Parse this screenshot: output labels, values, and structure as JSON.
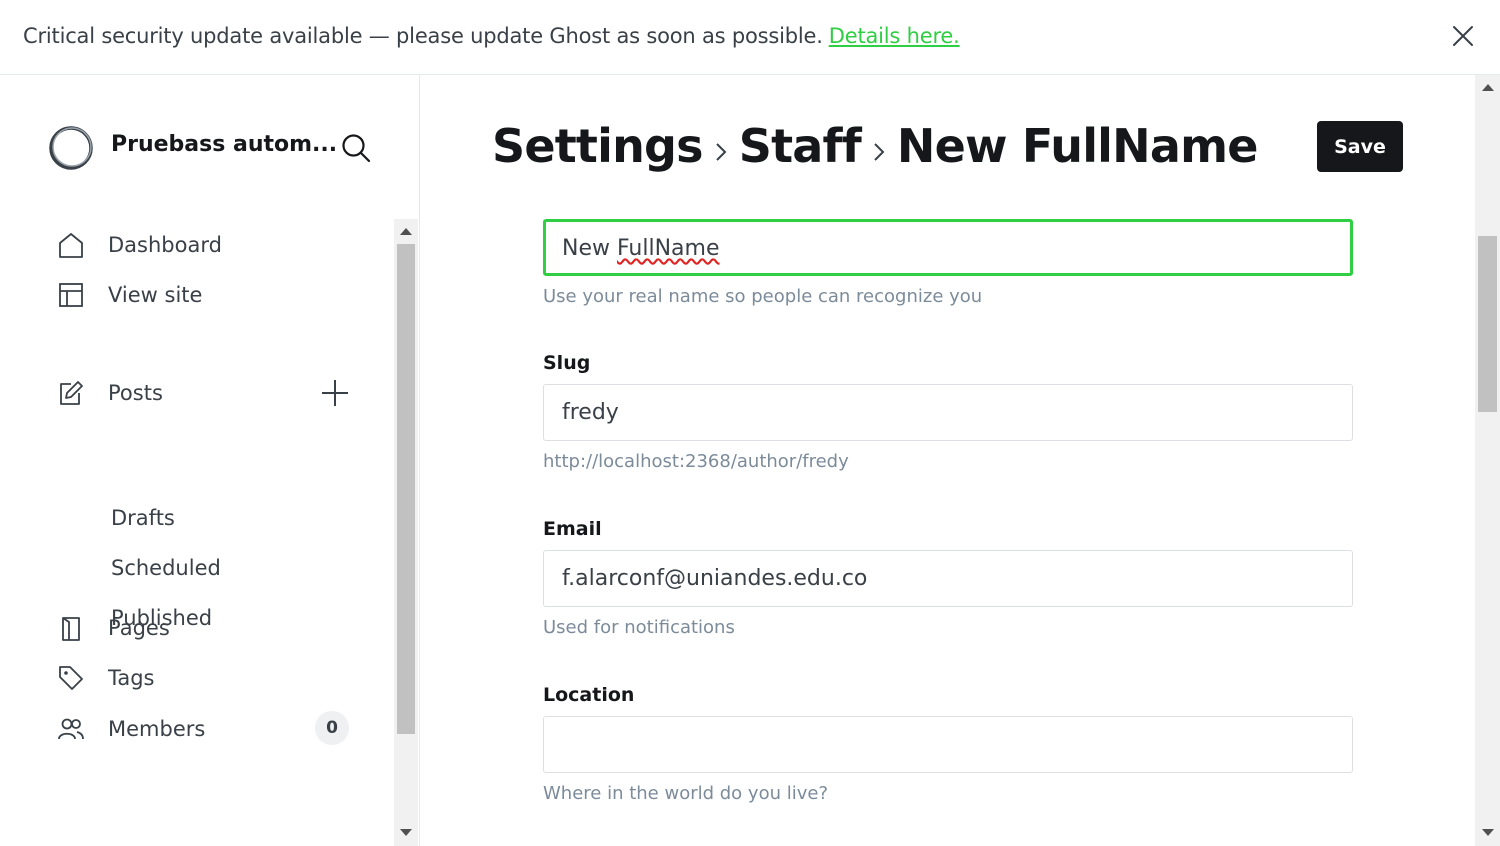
{
  "banner": {
    "message": "Critical security update available — please update Ghost as soon as possible.",
    "link_text": "Details here.",
    "close_icon": "close-icon"
  },
  "sidebar": {
    "site_title": "Pruebass autom...",
    "nav": [
      {
        "label": "Dashboard",
        "icon": "home-icon"
      },
      {
        "label": "View site",
        "icon": "layout-icon"
      },
      {
        "label": "Posts",
        "icon": "edit-icon"
      },
      {
        "label": "Pages",
        "icon": "page-icon"
      },
      {
        "label": "Tags",
        "icon": "tag-icon"
      },
      {
        "label": "Members",
        "icon": "members-icon"
      }
    ],
    "posts_sub": [
      "Drafts",
      "Scheduled",
      "Published"
    ],
    "members_count": "0"
  },
  "header": {
    "crumbs": [
      "Settings",
      "Staff",
      "New FullName"
    ],
    "save_label": "Save"
  },
  "form": {
    "name": {
      "value_prefix": "New ",
      "value_misspelled": "FullName",
      "hint": "Use your real name so people can recognize you"
    },
    "slug": {
      "label": "Slug",
      "value": "fredy",
      "hint": "http://localhost:2368/author/fredy"
    },
    "email": {
      "label": "Email",
      "value": "f.alarconf@uniandes.edu.co",
      "hint": "Used for notifications"
    },
    "location": {
      "label": "Location",
      "value": "",
      "hint": "Where in the world do you live?"
    }
  },
  "colors": {
    "accent": "#30cf43",
    "text": "#15171a",
    "muted": "#7c8b9a"
  }
}
